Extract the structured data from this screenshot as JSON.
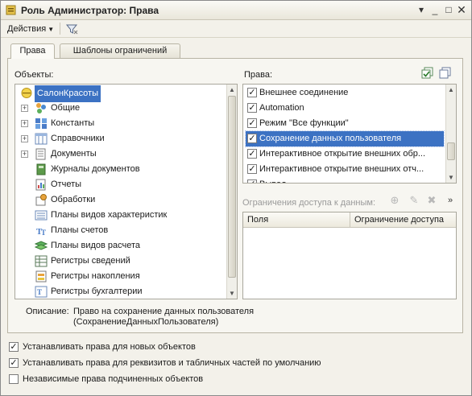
{
  "window": {
    "title": "Роль Администратор: Права"
  },
  "toolbar": {
    "actions_label": "Действия"
  },
  "tabs": [
    {
      "label": "Права",
      "active": true
    },
    {
      "label": "Шаблоны ограничений",
      "active": false
    }
  ],
  "objects": {
    "label": "Объекты:",
    "root": "СалонКрасоты",
    "items": [
      {
        "label": "Общие",
        "icon": "common-icon",
        "expandable": true
      },
      {
        "label": "Константы",
        "icon": "constants-icon",
        "expandable": true
      },
      {
        "label": "Справочники",
        "icon": "catalogs-icon",
        "expandable": true
      },
      {
        "label": "Документы",
        "icon": "documents-icon",
        "expandable": true
      },
      {
        "label": "Журналы документов",
        "icon": "journals-icon",
        "expandable": false
      },
      {
        "label": "Отчеты",
        "icon": "reports-icon",
        "expandable": false
      },
      {
        "label": "Обработки",
        "icon": "processing-icon",
        "expandable": false
      },
      {
        "label": "Планы видов характеристик",
        "icon": "char-plans-icon",
        "expandable": false
      },
      {
        "label": "Планы счетов",
        "icon": "accounts-icon",
        "expandable": false
      },
      {
        "label": "Планы видов расчета",
        "icon": "calc-plans-icon",
        "expandable": false
      },
      {
        "label": "Регистры сведений",
        "icon": "info-registers-icon",
        "expandable": false
      },
      {
        "label": "Регистры накопления",
        "icon": "accum-registers-icon",
        "expandable": false
      },
      {
        "label": "Регистры бухгалтерии",
        "icon": "acc-registers-icon",
        "expandable": false
      }
    ]
  },
  "rights": {
    "label": "Права:",
    "items": [
      {
        "label": "Внешнее соединение",
        "checked": true
      },
      {
        "label": "Automation",
        "checked": true
      },
      {
        "label": "Режим \"Все функции\"",
        "checked": true
      },
      {
        "label": "Сохранение данных пользователя",
        "checked": true,
        "selected": true
      },
      {
        "label": "Интерактивное открытие внешних обр...",
        "checked": true
      },
      {
        "label": "Интерактивное открытие внешних отч...",
        "checked": true
      },
      {
        "label": "Вывод",
        "checked": true
      }
    ]
  },
  "restrictions": {
    "label": "Ограничения доступа к данным:",
    "columns": [
      "Поля",
      "Ограничение доступа"
    ]
  },
  "description": {
    "label": "Описание:",
    "line1": "Право на сохранение данных пользователя",
    "line2": "(СохранениеДанныхПользователя)"
  },
  "options": [
    {
      "label": "Устанавливать права для новых объектов",
      "checked": true
    },
    {
      "label": "Устанавливать права для реквизитов и табличных частей по умолчанию",
      "checked": true
    },
    {
      "label": "Независимые права подчиненных объектов",
      "checked": false
    }
  ]
}
